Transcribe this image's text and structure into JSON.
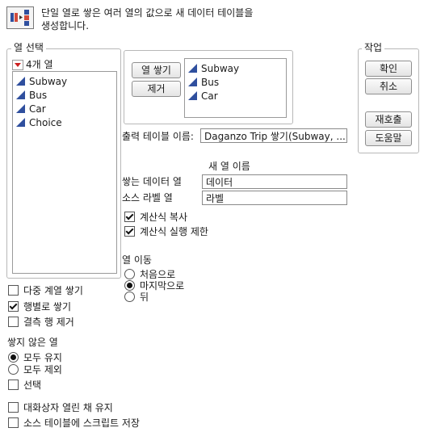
{
  "header": {
    "description": "단일 열로 쌓은 여러 열의 값으로 새 데이터 테이블을 생성합니다.",
    "description_line1": "단일 열로 쌓은 여러 열의 값으로 새 데이터 테이블을",
    "description_line2": "생성합니다."
  },
  "column_select": {
    "title": "열 선택",
    "count_label": "4개 열",
    "columns": [
      "Subway",
      "Bus",
      "Car",
      "Choice"
    ]
  },
  "stack_buttons": {
    "stack": "열 쌓기",
    "remove": "제거"
  },
  "stacked_list": [
    "Subway",
    "Bus",
    "Car"
  ],
  "output_table": {
    "label": "출력 테이블 이름:",
    "value": "Daganzo Trip 쌓기(Subway, ..."
  },
  "new_column_names": {
    "heading": "새 열 이름",
    "stacked_label": "쌓는 데이터 열",
    "stacked_value": "데이터",
    "source_label": "소스 라벨 열",
    "source_value": "라벨"
  },
  "formula_options": {
    "copy_formula": "계산식 복사",
    "suppress_eval": "계산식 실행 제한"
  },
  "move_columns": {
    "title": "열 이동",
    "options": [
      "처음으로",
      "마지막으로",
      "뒤"
    ],
    "selected": 1
  },
  "stack_options": {
    "multi_series": "다중 계열 쌓기",
    "by_row": "행별로 쌓기",
    "drop_missing": "결측 행 제거"
  },
  "non_stacked": {
    "title": "쌓지 않은 열",
    "options": [
      "모두 유지",
      "모두 제외"
    ],
    "selected": 0,
    "select_label": "선택"
  },
  "footer": {
    "keep_dialog_open": "대화상자 열린 채 유지",
    "save_script": "소스 테이블에 스크립트 저장"
  },
  "actions": {
    "title": "작업",
    "ok": "확인",
    "cancel": "취소",
    "recall": "재호출",
    "help": "도움말"
  },
  "colors": {
    "column_icon": "#2f4f9e",
    "red_triangle": "#cc1f1f",
    "border": "#b8b8b8"
  }
}
